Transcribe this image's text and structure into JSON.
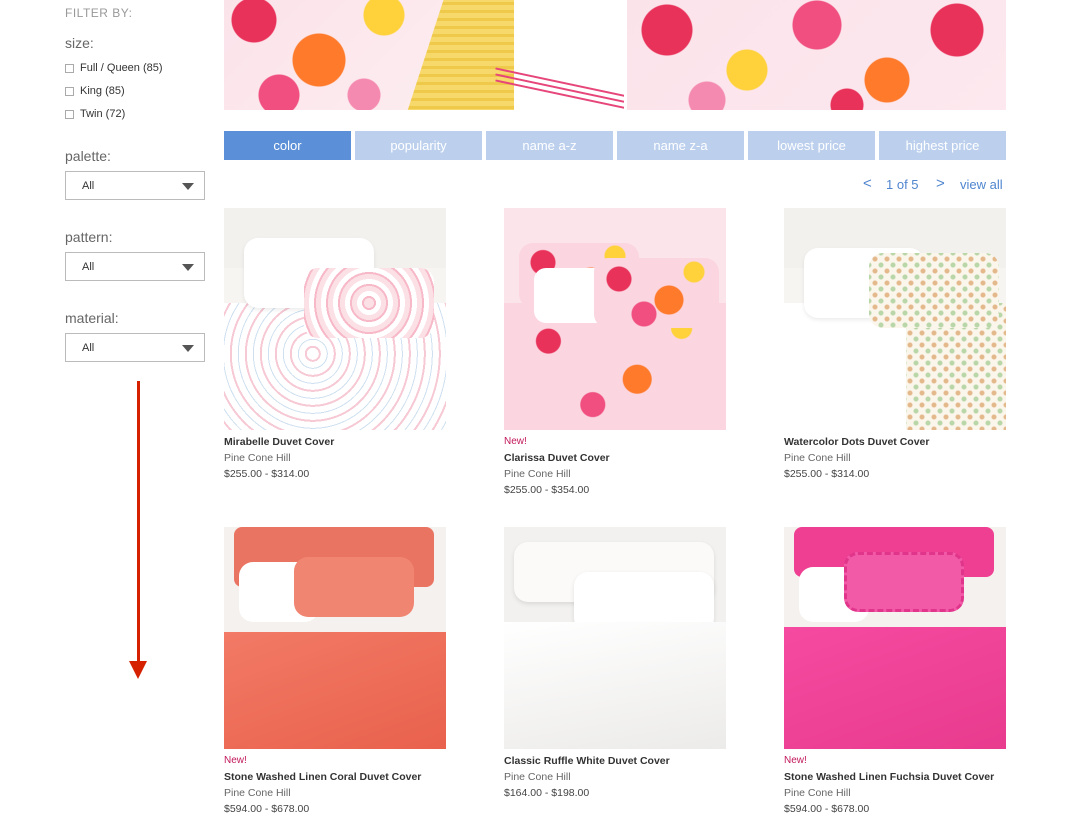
{
  "sidebar": {
    "filter_by": "FILTER BY:",
    "size": {
      "label": "size:",
      "options": [
        {
          "label": "Full / Queen (85)"
        },
        {
          "label": "King (85)"
        },
        {
          "label": "Twin (72)"
        }
      ]
    },
    "palette": {
      "label": "palette:",
      "value": "All"
    },
    "pattern": {
      "label": "pattern:",
      "value": "All"
    },
    "material": {
      "label": "material:",
      "value": "All"
    },
    "annotation_color": "#d62100"
  },
  "sort": {
    "active_color": "#5b8fd8",
    "inactive_color": "#bcd0ee",
    "tabs": [
      {
        "label": "color"
      },
      {
        "label": "popularity"
      },
      {
        "label": "name a-z"
      },
      {
        "label": "name z-a"
      },
      {
        "label": "lowest price"
      },
      {
        "label": "highest price"
      }
    ]
  },
  "pager": {
    "prev": "<",
    "page": "1 of 5",
    "next": ">",
    "view_all": "view all"
  },
  "products": [
    {
      "badge": "",
      "name": "Mirabelle Duvet Cover",
      "brand": "Pine Cone Hill",
      "price": "$255.00 - $314.00"
    },
    {
      "badge": "New!",
      "name": "Clarissa Duvet Cover",
      "brand": "Pine Cone Hill",
      "price": "$255.00 - $354.00"
    },
    {
      "badge": "",
      "name": "Watercolor Dots Duvet Cover",
      "brand": "Pine Cone Hill",
      "price": "$255.00 - $314.00"
    },
    {
      "badge": "New!",
      "name": "Stone Washed Linen Coral Duvet Cover",
      "brand": "Pine Cone Hill",
      "price": "$594.00 - $678.00"
    },
    {
      "badge": "",
      "name": "Classic Ruffle White Duvet Cover",
      "brand": "Pine Cone Hill",
      "price": "$164.00 - $198.00"
    },
    {
      "badge": "New!",
      "name": "Stone Washed Linen Fuchsia Duvet Cover",
      "brand": "Pine Cone Hill",
      "price": "$594.00 - $678.00"
    }
  ]
}
